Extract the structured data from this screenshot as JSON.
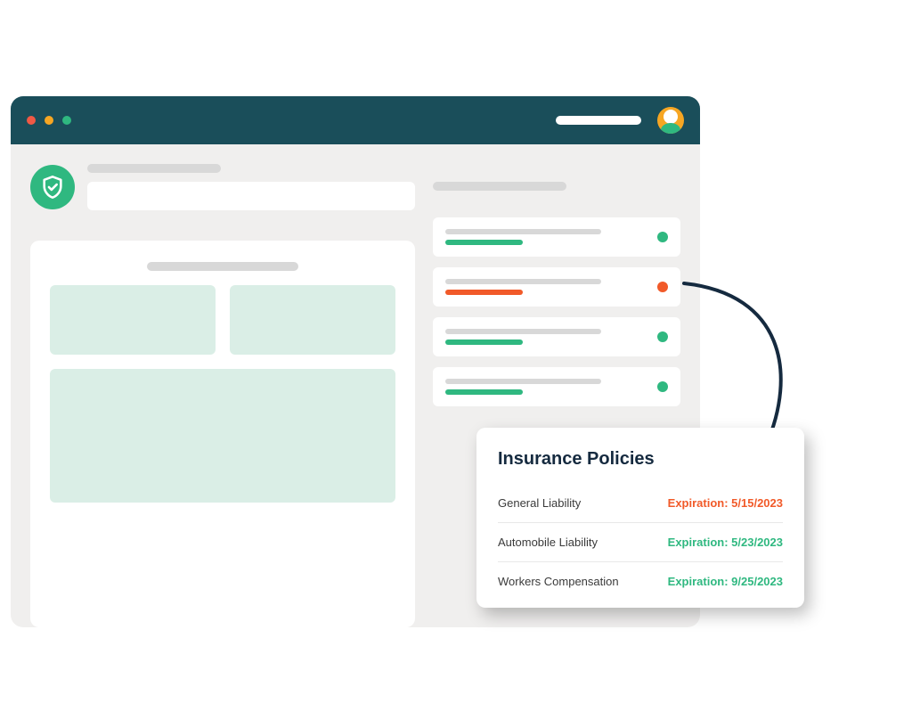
{
  "colors": {
    "header_bg": "#1a4e5a",
    "accent_green": "#2fb880",
    "accent_orange": "#f15a29",
    "accent_yellow": "#f6a623"
  },
  "status_items": [
    {
      "status": "green"
    },
    {
      "status": "orange"
    },
    {
      "status": "green"
    },
    {
      "status": "green"
    }
  ],
  "callout": {
    "title": "Insurance Policies",
    "rows": [
      {
        "name": "General Liability",
        "expiration_label": "Expiration: 5/15/2023",
        "state": "warn"
      },
      {
        "name": "Automobile Liability",
        "expiration_label": "Expiration: 5/23/2023",
        "state": "ok"
      },
      {
        "name": "Workers Compensation",
        "expiration_label": "Expiration: 9/25/2023",
        "state": "ok"
      }
    ]
  }
}
